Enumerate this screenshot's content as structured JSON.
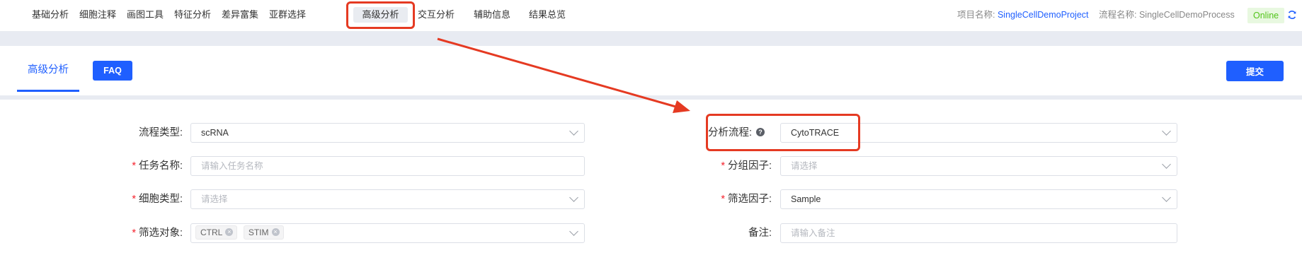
{
  "nav": {
    "items": [
      {
        "label": "基础分析"
      },
      {
        "label": "细胞注释"
      },
      {
        "label": "画图工具"
      },
      {
        "label": "特征分析"
      },
      {
        "label": "差异富集"
      },
      {
        "label": "亚群选择"
      },
      {
        "label": "高级分析",
        "active": true
      },
      {
        "label": "交互分析"
      },
      {
        "label": "辅助信息"
      },
      {
        "label": "结果总览"
      }
    ],
    "project_label": "项目名称:",
    "project_value": "SingleCellDemoProject",
    "process_label": "流程名称:",
    "process_value": "SingleCellDemoProcess",
    "status": "Online",
    "refresh_icon": "refresh-icon"
  },
  "tabs": {
    "active": "高级分析",
    "faq": "FAQ",
    "submit": "提交"
  },
  "form": {
    "pipeline_type": {
      "label": "流程类型:",
      "value": "scRNA"
    },
    "task_name": {
      "label": "任务名称:",
      "placeholder": "请输入任务名称",
      "required": true
    },
    "cell_type": {
      "label": "细胞类型:",
      "placeholder": "请选择",
      "required": true
    },
    "filter_object": {
      "label": "筛选对象:",
      "tags": [
        "CTRL",
        "STIM"
      ],
      "required": true
    },
    "analysis_flow": {
      "label": "分析流程:",
      "value": "CytoTRACE",
      "help_icon": "question-icon"
    },
    "group_factor": {
      "label": "分组因子:",
      "placeholder": "请选择",
      "required": true
    },
    "filter_factor": {
      "label": "筛选因子:",
      "value": "Sample",
      "required": true
    },
    "remark": {
      "label": "备注:",
      "placeholder": "请输入备注"
    }
  },
  "colors": {
    "accent": "#1f5fff",
    "annotation": "#e53a22",
    "required": "#f5222d",
    "online": "#52c41a"
  }
}
